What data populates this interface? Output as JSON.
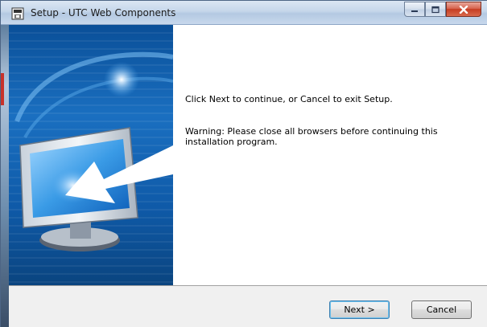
{
  "window": {
    "title": "Setup - UTC Web Components",
    "icons": {
      "app": "setup-icon",
      "minimize": "minimize-icon",
      "maximize": "maximize-icon",
      "close": "close-icon"
    }
  },
  "banner": {
    "image": "computer-monitor-with-arrow-illustration"
  },
  "content": {
    "message": "Click Next to continue, or Cancel to exit Setup.",
    "warning": "Warning: Please close all browsers before continuing this installation program."
  },
  "buttons": {
    "next": "Next >",
    "cancel": "Cancel"
  },
  "colors": {
    "banner_dark": "#0b5aa6",
    "banner_light": "#39a0e6",
    "titlebar": "#c5d6ea",
    "close_button": "#c53c22"
  }
}
